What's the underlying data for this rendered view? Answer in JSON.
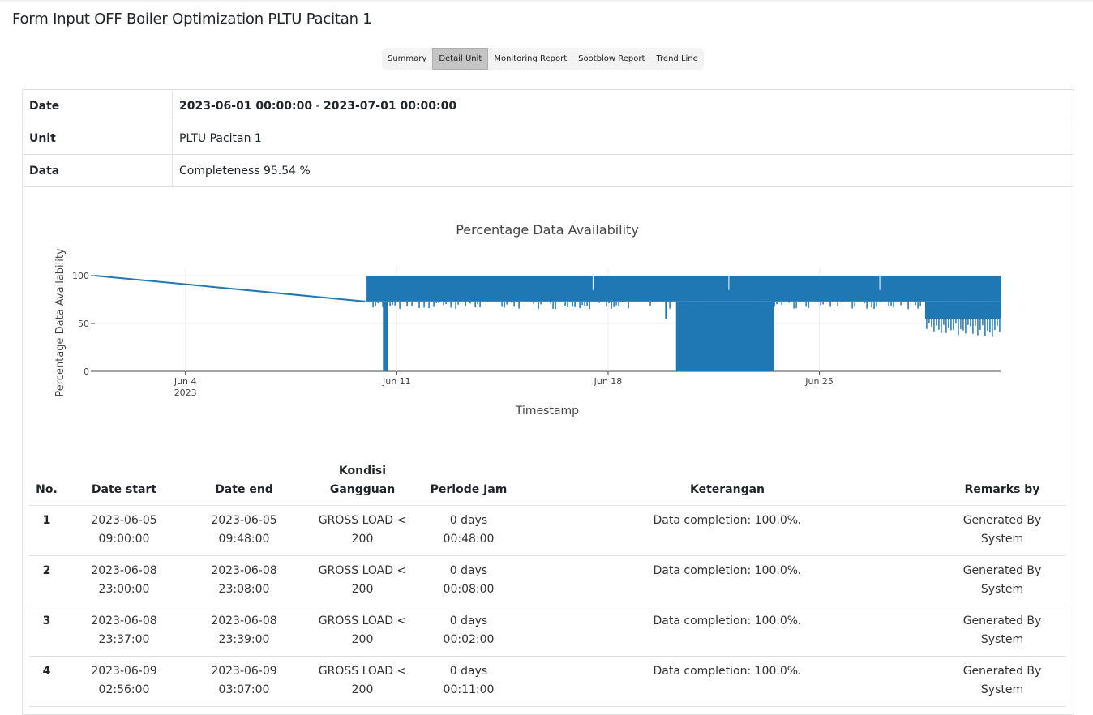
{
  "page": {
    "title": "Form Input OFF Boiler Optimization PLTU Pacitan 1"
  },
  "tabs": [
    "Summary",
    "Detail Unit",
    "Monitoring Report",
    "Sootblow Report",
    "Trend Line"
  ],
  "active_tab": "Detail Unit",
  "info": {
    "date_label": "Date",
    "date_start": "2023-06-01 00:00:00",
    "date_sep": " - ",
    "date_end": "2023-07-01 00:00:00",
    "unit_label": "Unit",
    "unit_value": "PLTU Pacitan 1",
    "data_label": "Data",
    "data_value": "Completeness 95.54 %"
  },
  "chart_data": {
    "type": "line",
    "title": "Percentage Data Availability",
    "xlabel": "Timestamp",
    "ylabel": "Percentage Data Availability",
    "ylim": [
      0,
      100
    ],
    "yticks": [
      0,
      50,
      100
    ],
    "xticks": [
      "Jun 4",
      "Jun 11",
      "Jun 18",
      "Jun 25"
    ],
    "xtick_sub": "2023",
    "xlim": [
      "2023-06-01",
      "2023-07-01"
    ],
    "grid": true,
    "color": "#1f77b4",
    "series": [
      {
        "values": [
          {
            "x": "2023-06-01 00:00",
            "y": 100
          },
          {
            "x": "2023-06-09 23:00",
            "y": 73
          },
          {
            "x": "2023-06-10 00:00",
            "y": 100
          },
          {
            "x": "2023-06-10 14:00",
            "y": 0
          },
          {
            "x": "2023-06-10 15:00",
            "y": 100
          },
          {
            "x": "2023-06-20 06:00",
            "y": 55
          },
          {
            "x": "2023-06-21 00:00",
            "y": 0
          },
          {
            "x": "2023-06-23 10:00",
            "y": 100
          },
          {
            "x": "2023-06-28 12:00",
            "y": 45
          },
          {
            "x": "2023-06-29 00:00",
            "y": 36
          },
          {
            "x": "2023-06-30 23:00",
            "y": 47
          }
        ]
      }
    ]
  },
  "table": {
    "headers": {
      "no": "No.",
      "date_start": "Date start",
      "date_end": "Date end",
      "kondisi_1": "Kondisi",
      "kondisi_2": "Gangguan",
      "periode": "Periode Jam",
      "keterangan": "Keterangan",
      "remarks": "Remarks by"
    },
    "rows": [
      {
        "no": "1",
        "start_d": "2023-06-05",
        "start_t": "09:00:00",
        "end_d": "2023-06-05",
        "end_t": "09:48:00",
        "k1": "GROSS LOAD <",
        "k2": "200",
        "p1": "0 days",
        "p2": "00:48:00",
        "ket": "Data completion: 100.0%.",
        "r1": "Generated By",
        "r2": "System"
      },
      {
        "no": "2",
        "start_d": "2023-06-08",
        "start_t": "23:00:00",
        "end_d": "2023-06-08",
        "end_t": "23:08:00",
        "k1": "GROSS LOAD <",
        "k2": "200",
        "p1": "0 days",
        "p2": "00:08:00",
        "ket": "Data completion: 100.0%.",
        "r1": "Generated By",
        "r2": "System"
      },
      {
        "no": "3",
        "start_d": "2023-06-08",
        "start_t": "23:37:00",
        "end_d": "2023-06-08",
        "end_t": "23:39:00",
        "k1": "GROSS LOAD <",
        "k2": "200",
        "p1": "0 days",
        "p2": "00:02:00",
        "ket": "Data completion: 100.0%.",
        "r1": "Generated By",
        "r2": "System"
      },
      {
        "no": "4",
        "start_d": "2023-06-09",
        "start_t": "02:56:00",
        "end_d": "2023-06-09",
        "end_t": "03:07:00",
        "k1": "GROSS LOAD <",
        "k2": "200",
        "p1": "0 days",
        "p2": "00:11:00",
        "ket": "Data completion: 100.0%.",
        "r1": "Generated By",
        "r2": "System"
      }
    ]
  }
}
